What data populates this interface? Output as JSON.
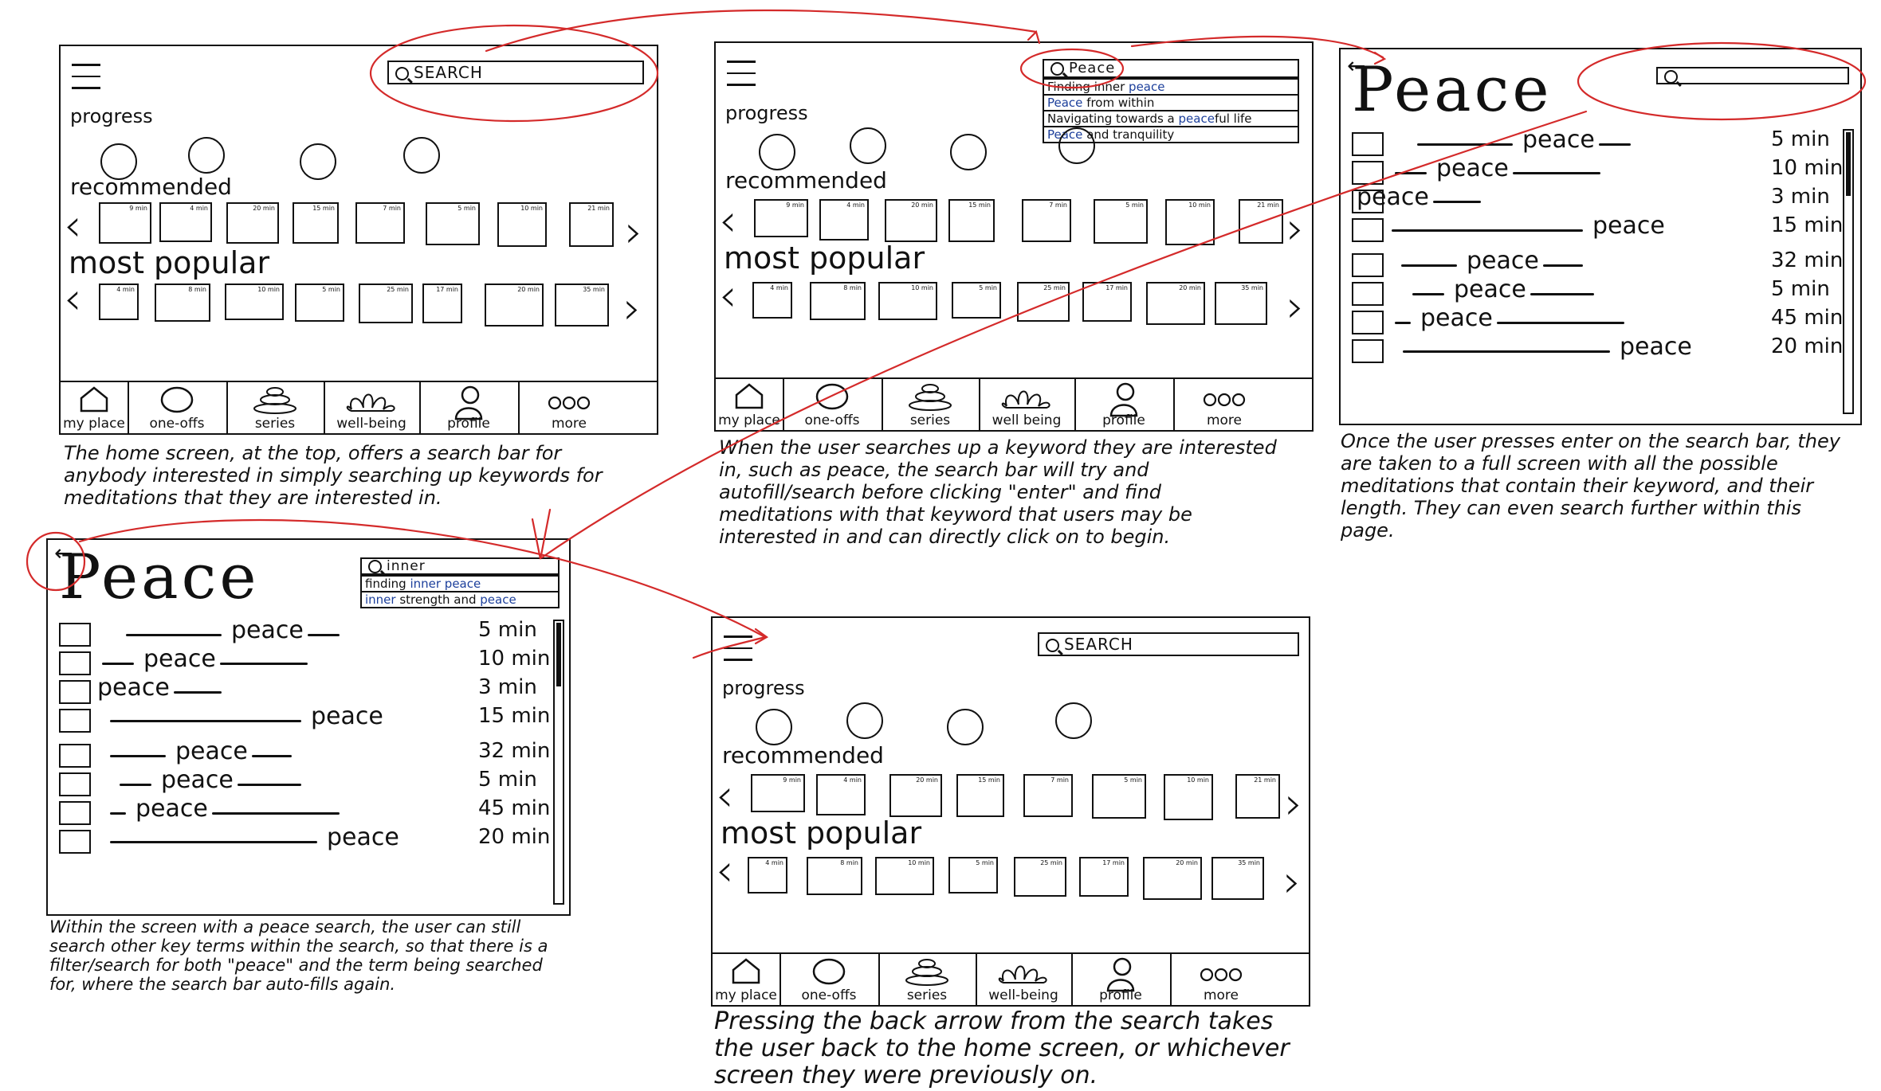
{
  "home": {
    "search_label": "SEARCH",
    "progress_label": "progress",
    "recommended_label": "recommended",
    "popular_label": "most popular",
    "rec_durations": [
      "9 min",
      "4 min",
      "20 min",
      "15 min",
      "7 min",
      "5 min",
      "10 min",
      "21 min"
    ],
    "pop_durations": [
      "4 min",
      "8 min",
      "10 min",
      "5 min",
      "25 min",
      "17 min",
      "20 min",
      "35 min"
    ],
    "nav": [
      "my place",
      "one-offs",
      "series",
      "well-being",
      "profile",
      "more"
    ]
  },
  "autofill": {
    "query": "Peace",
    "suggestions": [
      [
        {
          "t": "Finding inner ",
          "b": false
        },
        {
          "t": "peace",
          "b": true
        }
      ],
      [
        {
          "t": "Peace",
          "b": true
        },
        {
          "t": " from within",
          "b": false
        }
      ],
      [
        {
          "t": "Navigating towards a ",
          "b": false
        },
        {
          "t": "peace",
          "b": true
        },
        {
          "t": "ful life",
          "b": false
        }
      ],
      [
        {
          "t": "Peace",
          "b": true
        },
        {
          "t": " and tranquility",
          "b": false
        }
      ]
    ],
    "nav": [
      "my place",
      "one-offs",
      "series",
      "well being",
      "profile",
      "more"
    ]
  },
  "results": {
    "title": "Peace",
    "word": "peace",
    "durations": [
      "5 min",
      "10 min",
      "3 min",
      "15 min",
      "32 min",
      "5 min",
      "45 min",
      "20 min"
    ]
  },
  "inner_search": {
    "title": "Peace",
    "query": "inner",
    "suggestions": [
      [
        {
          "t": "finding ",
          "b": false
        },
        {
          "t": "inner peace",
          "b": true
        }
      ],
      [
        {
          "t": "inner",
          "b": true
        },
        {
          "t": " strength and ",
          "b": false
        },
        {
          "t": "peace",
          "b": true
        }
      ]
    ]
  },
  "captions": {
    "c1": "The home screen, at the top, offers a search bar for anybody interested in simply searching up keywords for meditations that they are interested in.",
    "c2": "When the user searches up a keyword they are interested in, such as peace, the search bar will try and autofill/search before clicking \"enter\" and find meditations with that keyword that users may be interested in and can directly click on to begin.",
    "c3": "Once the user presses enter on the search bar, they are taken to a full screen with all the possible meditations that contain their keyword, and their length. They can even search further within this page.",
    "c4": "Within the screen with a peace search, the user can still search other key terms within the search, so that there is a filter/search for both \"peace\" and the term being searched for, where the search bar auto-fills again.",
    "c5": "Pressing the back arrow from the search takes the user back to the home screen, or whichever screen they were previously on."
  },
  "colors": {
    "ink": "#111111",
    "annotation_red": "#d42a2a",
    "highlight_blue": "#1c3f9b"
  }
}
